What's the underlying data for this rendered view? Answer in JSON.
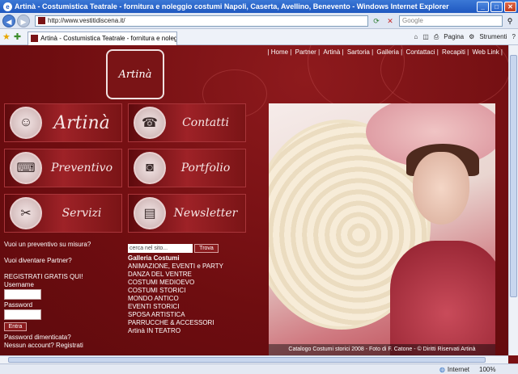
{
  "window": {
    "title": "Artinà - Costumistica Teatrale - fornitura e noleggio costumi Napoli, Caserta, Avellino, Benevento - Windows Internet Explorer",
    "address": "http://www.vestitidiscena.it/",
    "search_placeholder": "Google",
    "tab_title": "Artinà - Costumistica Teatrale - fornitura e noleggio c...",
    "tools": [
      "Pagina",
      "Strumenti"
    ]
  },
  "site": {
    "logo": "Artinà",
    "topnav": [
      "| Home |",
      "Partner |",
      "Artinà |",
      "Sartoria |",
      "Galleria |",
      "Contattaci |",
      "Recapiti |",
      "Web Link |"
    ],
    "tiles": [
      {
        "label": "Artinà",
        "icon": "lady-portrait-icon"
      },
      {
        "label": "Contatti",
        "icon": "telephone-icon"
      },
      {
        "label": "Preventivo",
        "icon": "typewriter-icon"
      },
      {
        "label": "Portfolio",
        "icon": "camera-icon"
      },
      {
        "label": "Servizi",
        "icon": "sewing-machine-icon"
      },
      {
        "label": "Newsletter",
        "icon": "radio-icon"
      }
    ],
    "left": {
      "quote_link": "Vuoi un preventivo su misura?",
      "partner_link": "Vuoi diventare Partner?",
      "register_link": "REGISTRATI GRATIS QUI!",
      "username_label": "Username",
      "password_label": "Password",
      "login_button": "Entra",
      "forgot_link": "Password dimenticata?",
      "register_prompt": "Nessun account? Registrati"
    },
    "catalog": {
      "search_placeholder": "cerca nel sito...",
      "search_button": "Trova",
      "items": [
        "Galleria Costumi",
        "ANIMAZIONE, EVENTI e PARTY",
        "DANZA DEL VENTRE",
        "COSTUMI MEDIOEVO",
        "COSTUMI STORICI",
        "MONDO ANTICO",
        "EVENTI STORICI",
        "SPOSA ARTISTICA",
        "PARRUCCHE & ACCESSORI",
        "Artinà IN TEATRO"
      ]
    },
    "photo_caption": "Catalogo Costumi storici 2008 - Foto di F. Catone - © Diritti Riservati Artinà"
  },
  "status": {
    "zone": "Internet",
    "zoom": "100%"
  },
  "colors": {
    "brand_red": "#7a1416",
    "ie_blue": "#1f58c0"
  }
}
